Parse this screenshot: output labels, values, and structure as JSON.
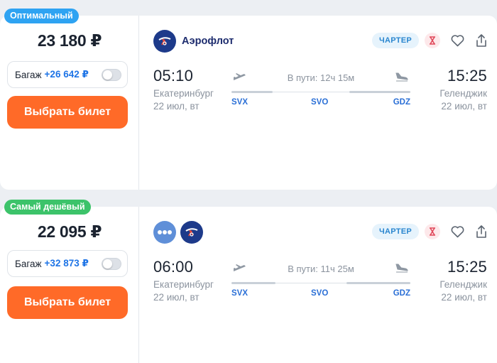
{
  "offers": [
    {
      "badge": "Оптимальный",
      "badge_color": "#2ea3f2",
      "price": "23 180 ₽",
      "baggage_label": "Багаж",
      "baggage_price": "+26 642 ₽",
      "buy_label": "Выбрать билет",
      "airline": "Аэрофлот",
      "charter": "ЧАРТЕР",
      "dep_time": "05:10",
      "dep_city": "Екатеринбург",
      "dep_date": "22 июл, вт",
      "duration": "В пути: 12ч 15м",
      "arr_time": "15:25",
      "arr_city": "Геленджик",
      "arr_date": "22 июл, вт",
      "codes": [
        "SVX",
        "SVO",
        "GDZ"
      ]
    },
    {
      "badge": "Самый дешёвый",
      "badge_color": "#3cc36a",
      "price": "22 095 ₽",
      "baggage_label": "Багаж",
      "baggage_price": "+32 873 ₽",
      "buy_label": "Выбрать билет",
      "charter": "ЧАРТЕР",
      "dep_time": "06:00",
      "dep_city": "Екатеринбург",
      "dep_date": "22 июл, вт",
      "duration": "В пути: 11ч 25м",
      "arr_time": "15:25",
      "arr_city": "Геленджик",
      "arr_date": "22 июл, вт",
      "codes": [
        "SVX",
        "SVO",
        "GDZ"
      ]
    }
  ],
  "icons": [
    "aeroflot-logo-icon",
    "multi-airline-icon",
    "hourglass-icon",
    "heart-icon",
    "share-icon",
    "takeoff-icon",
    "landing-icon"
  ],
  "colors": {
    "accent": "#ff6a28",
    "link": "#1e74e6",
    "charter_bg": "#e6f3fc"
  }
}
